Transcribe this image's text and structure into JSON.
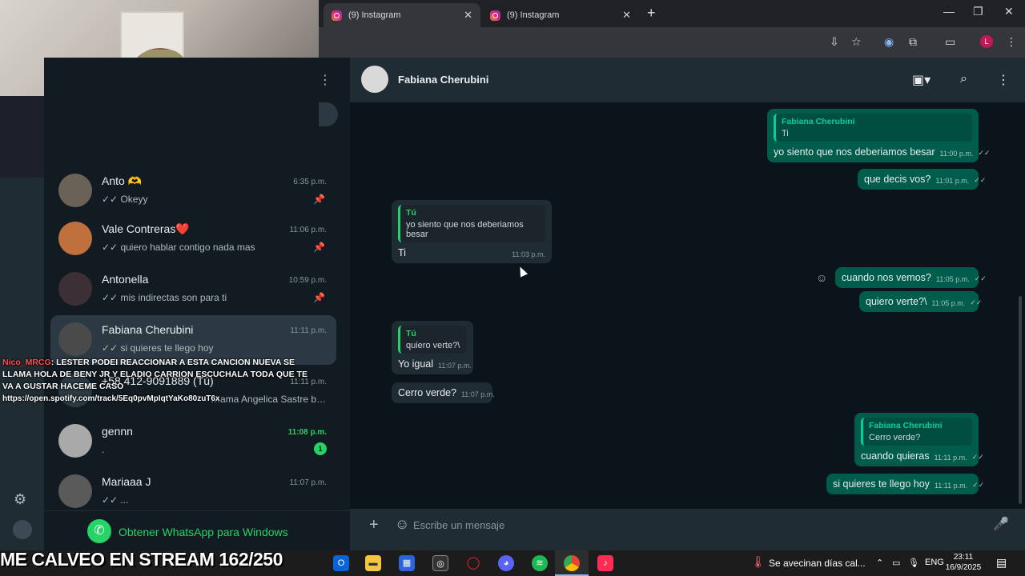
{
  "browser": {
    "tabs": [
      {
        "label": "(9) Instagram",
        "active": true
      },
      {
        "label": "(9) Instagram",
        "active": false
      }
    ],
    "new_tab": "+",
    "profile_initial": "L",
    "min": "—",
    "max": "❐",
    "close": "✕"
  },
  "sidebar": {
    "chats": [
      {
        "name": "Anto 🫶",
        "time": "6:35 p.m.",
        "preview": "✓✓ Okeyy",
        "pinned": true,
        "avatar_color": "#6b6257"
      },
      {
        "name": "Vale Contreras❤️",
        "time": "11:06 p.m.",
        "preview": "✓✓ quiero hablar contigo nada mas",
        "pinned": true,
        "avatar_color": "#c0703c"
      },
      {
        "name": "Antonella",
        "time": "10:59 p.m.",
        "preview": "✓✓ mis indirectas son para ti",
        "pinned": true,
        "avatar_color": "#3c3036"
      },
      {
        "name": "Fabiana Cherubini",
        "time": "11:11 p.m.",
        "preview": "✓✓ si quieres te llego hoy",
        "pinned": false,
        "avatar_color": "#4a4a4a"
      },
      {
        "name": "+58 412-9091889 (Tú)",
        "time": "11:11 p.m.",
        "preview": "…ama Angelica Sastre b…",
        "pinned": false,
        "avatar_color": "#2a3942"
      },
      {
        "name": "gennn",
        "time": "11:08 p.m.",
        "preview": ".",
        "pinned": false,
        "unread": "1",
        "avatar_color": "#a9a9a9"
      },
      {
        "name": "Mariaaa J",
        "time": "11:07 p.m.",
        "preview": "✓✓ ...",
        "pinned": false,
        "avatar_color": "#5a5a5a"
      }
    ],
    "get_app_label": "Obtener WhatsApp para Windows"
  },
  "stream_overlay": {
    "user": "Nico_MRCG",
    "message": ": LESTER PODEI REACCIONAR A ESTA CANCION NUEVA SE LLAMA HOLA DE BENY JR Y ELADIO CARRION ESCUCHALA TODA QUE TE VA A GUSTAR HACEME CASO",
    "link": "https://open.spotify.com/track/5Eq0pvMpIqtYaKo80zuT6x",
    "goal": "ME CALVEO EN STREAM 162/250"
  },
  "conversation": {
    "contact_name": "Fabiana Cherubini",
    "messages": [
      {
        "dir": "out",
        "quote_name": "Fabiana Cherubini",
        "quote_text": "Ti",
        "text": "yo siento que nos deberiamos besar",
        "time": "11:00 p.m.",
        "ticks": "✓✓"
      },
      {
        "dir": "out",
        "text": "que decis vos?",
        "time": "11:01 p.m.",
        "ticks": "✓✓"
      },
      {
        "dir": "in",
        "quote_name": "Tú",
        "quote_text": "yo siento que nos deberiamos besar",
        "text": "Ti",
        "time": "11:03 p.m."
      },
      {
        "dir": "out",
        "text": "cuando nos vemos?",
        "time": "11:05 p.m.",
        "ticks": "✓✓"
      },
      {
        "dir": "out",
        "text": "quiero verte?\\",
        "time": "11:05 p.m.",
        "ticks": "✓✓"
      },
      {
        "dir": "in",
        "quote_name": "Tú",
        "quote_text": "quiero verte?\\",
        "text": "Yo igual",
        "time": "11:07 p.m."
      },
      {
        "dir": "in",
        "text": "Cerro verde?",
        "time": "11:07 p.m."
      },
      {
        "dir": "out",
        "quote_name": "Fabiana Cherubini",
        "quote_text": "Cerro verde?",
        "text": "cuando quieras",
        "time": "11:11 p.m.",
        "ticks": "✓✓"
      },
      {
        "dir": "out",
        "text": "si quieres te llego hoy",
        "time": "11:11 p.m.",
        "ticks": "✓✓"
      }
    ],
    "composer_placeholder": "Escribe un mensaje"
  },
  "taskbar": {
    "weather": "Se avecinan días cal...",
    "lang": "ENG",
    "time": "23:11",
    "date": "16/9/2025"
  },
  "colors": {
    "accent": "#25d366",
    "outgoing": "#005c4b",
    "incoming": "#202c33"
  }
}
